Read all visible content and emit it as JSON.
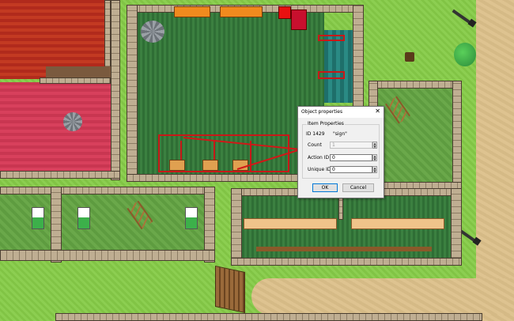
{
  "dialog": {
    "title": "Object properties",
    "close_glyph": "✕",
    "group_label": "Item Properties",
    "id_label": "ID 1429",
    "type_name": "\"sign\"",
    "count_label": "Count",
    "count_value": "1",
    "action_id_label": "Action ID",
    "action_id_value": "0",
    "unique_id_label": "Unique ID",
    "unique_id_value": "0",
    "ok_label": "OK",
    "cancel_label": "Cancel"
  },
  "colors": {
    "grass": "#86cc48",
    "sand": "#dcc08a",
    "arrow": "#d01818",
    "dialog_bg": "#f0f0f0",
    "accent": "#0078d7"
  },
  "icons": {
    "spin_up": "▲",
    "spin_down": "▼"
  }
}
